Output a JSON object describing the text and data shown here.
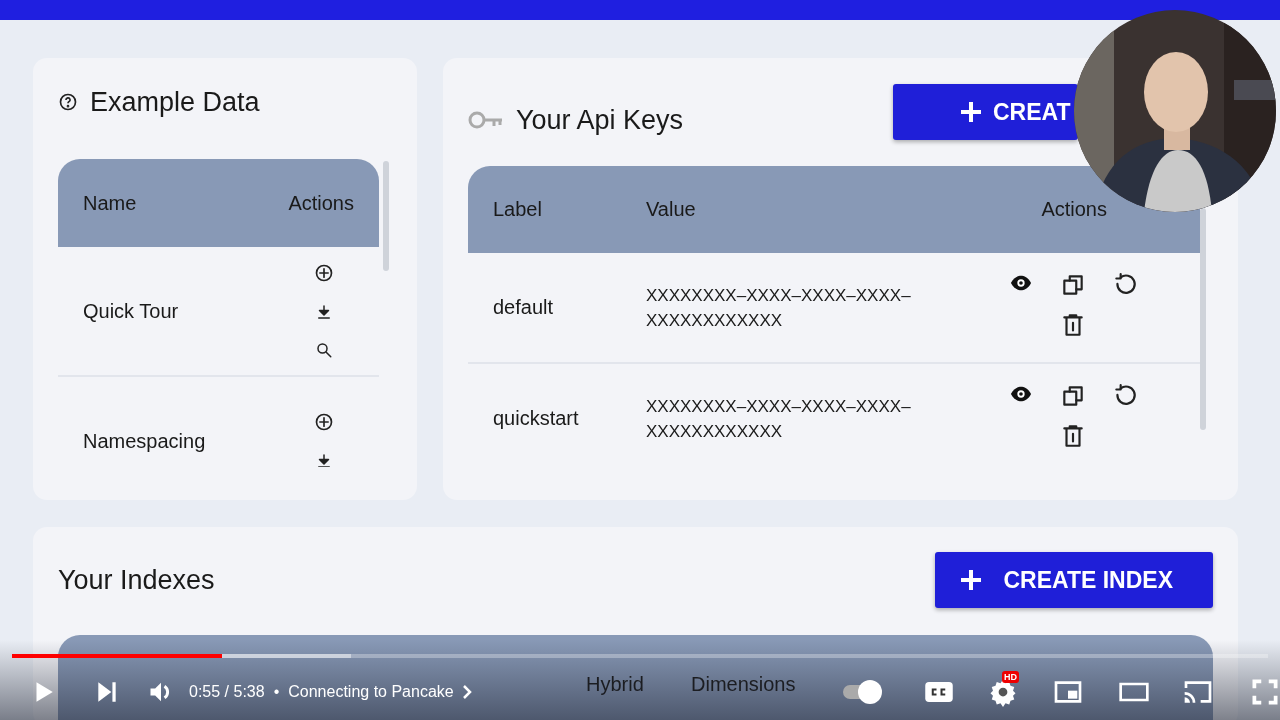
{
  "example_data": {
    "title": "Example Data",
    "columns": [
      "Name",
      "Actions"
    ],
    "rows": [
      {
        "name": "Quick Tour",
        "actions": [
          {
            "kind": "add"
          },
          {
            "kind": "download"
          },
          {
            "kind": "search"
          }
        ]
      },
      {
        "name": "Namespacing",
        "actions": [
          {
            "kind": "add"
          },
          {
            "kind": "download"
          }
        ]
      }
    ]
  },
  "api_keys": {
    "title": "Your Api Keys",
    "create_button": "CREAT",
    "columns": [
      "Label",
      "Value",
      "Actions"
    ],
    "rows": [
      {
        "label": "default",
        "value": "XXXXXXXX–XXXX–XXXX–XXXX–XXXXXXXXXXXX"
      },
      {
        "label": "quickstart",
        "value": "XXXXXXXX–XXXX–XXXX–XXXX–XXXXXXXXXXXX"
      }
    ]
  },
  "indexes": {
    "title": "Your Indexes",
    "create_button": "CREATE INDEX",
    "columns": [
      "Hybrid",
      "Dimensions"
    ]
  },
  "video_player": {
    "progress": {
      "level": 0.167
    },
    "time": "0:55 / 5:38",
    "separator": "•",
    "chapter": "Connecting to Pancake",
    "autoplay": {
      "on": true
    },
    "settings_badge": "HD"
  }
}
